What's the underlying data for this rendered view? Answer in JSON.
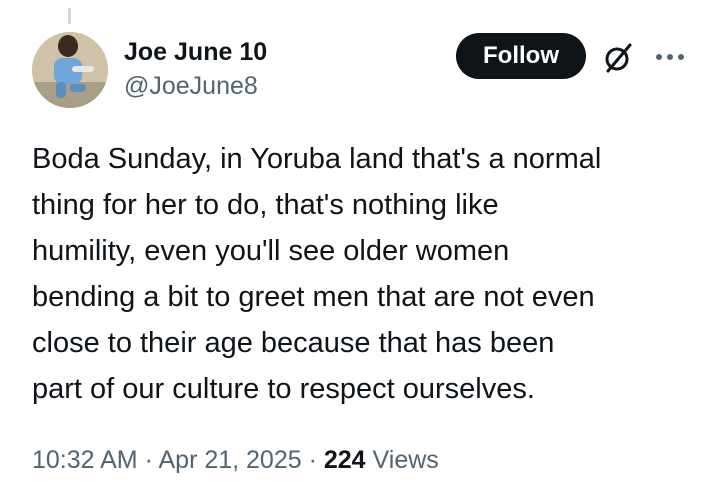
{
  "author": {
    "display_name": "Joe June 10",
    "handle": "@JoeJune8"
  },
  "actions": {
    "follow_label": "Follow",
    "grok_icon": "grok-slash-icon",
    "more_icon": "more-horizontal-icon"
  },
  "tweet": {
    "lines": [
      "Boda Sunday, in Yoruba land that's a normal",
      "thing for her to do, that's nothing like",
      "humility, even you'll see older women",
      "bending a bit to greet men that are not even",
      "close to their age because that has been",
      "part of our culture to respect ourselves."
    ]
  },
  "meta": {
    "time": "10:32 AM",
    "separator1": " · ",
    "date": "Apr 21, 2025",
    "separator2": " · ",
    "views_count": "224",
    "views_label": " Views"
  },
  "colors": {
    "text_primary": "#0f1419",
    "text_secondary": "#536471",
    "button_bg": "#0f1419",
    "button_text": "#ffffff"
  }
}
